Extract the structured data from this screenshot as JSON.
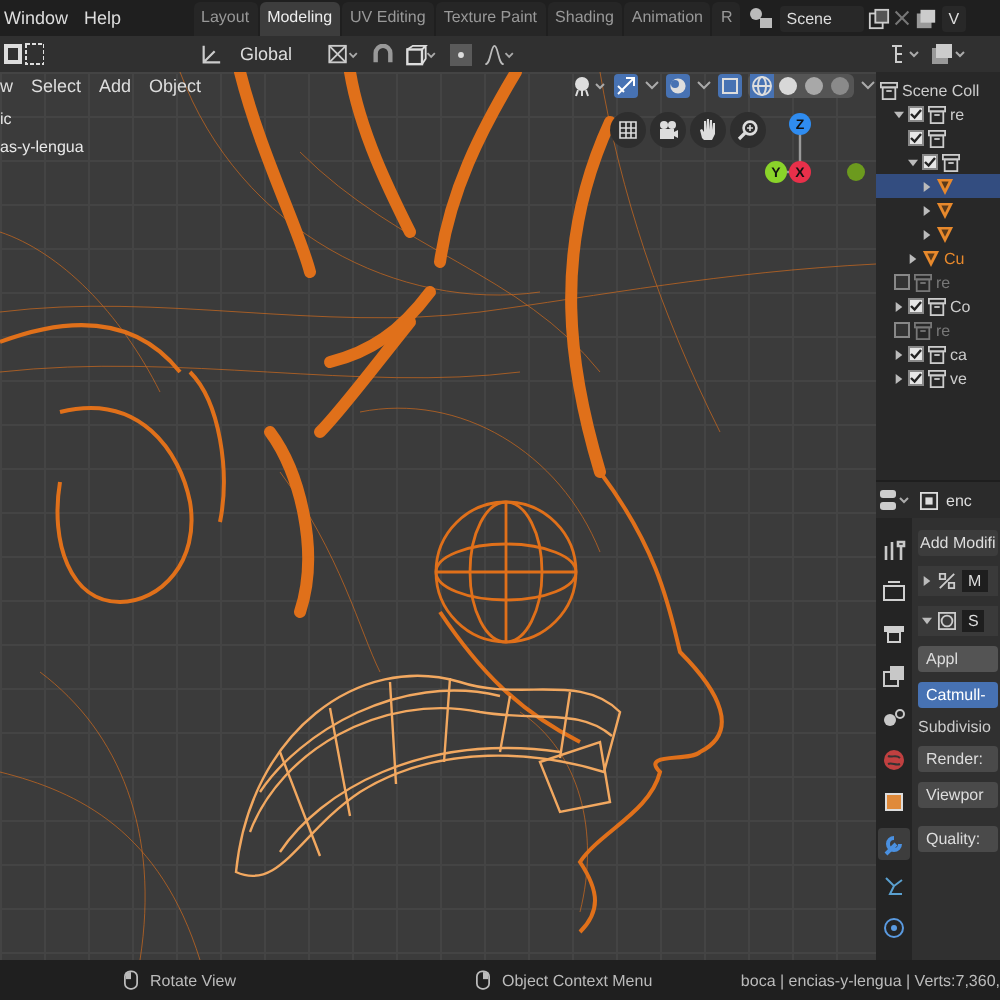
{
  "top_bar": {
    "menus": [
      "Window",
      "Help"
    ],
    "workspace_tabs": [
      {
        "label": "Layout",
        "selected": false
      },
      {
        "label": "Modeling",
        "selected": true
      },
      {
        "label": "UV Editing",
        "selected": false
      },
      {
        "label": "Texture Paint",
        "selected": false
      },
      {
        "label": "Shading",
        "selected": false
      },
      {
        "label": "Animation",
        "selected": false
      },
      {
        "label": "R",
        "selected": false
      }
    ],
    "scene": "Scene",
    "view_layer": "V"
  },
  "tool_header": {
    "orientation": "Global"
  },
  "viewport": {
    "menus": [
      "w",
      "Select",
      "Add",
      "Object"
    ],
    "overlay_text": [
      "ic",
      "as-y-lengua"
    ],
    "shading_buttons": [
      {
        "kind": "wireframe",
        "selected": true
      },
      {
        "kind": "solid",
        "selected": false
      },
      {
        "kind": "material",
        "selected": false
      },
      {
        "kind": "rendered",
        "selected": false
      }
    ],
    "gizmo_axes": [
      {
        "label": "Z",
        "color": "#2f8cf0"
      },
      {
        "label": "Y",
        "color": "#8ad42a"
      },
      {
        "label": "X",
        "color": "#e8304a"
      }
    ]
  },
  "outliner": {
    "items": [
      {
        "label": "Scene Coll",
        "kind": "collection",
        "selected": false,
        "children": [
          {
            "label": "re",
            "kind": "collection",
            "checked": true,
            "expanded": true,
            "selected": false,
            "children": [
              {
                "kind": "collection",
                "checked": true,
                "selected": false
              },
              {
                "kind": "collection",
                "checked": true,
                "expanded": true,
                "selected": false,
                "children": [
                  {
                    "kind": "mesh",
                    "expanded": false,
                    "selected": true
                  },
                  {
                    "kind": "mesh",
                    "expanded": false,
                    "selected": false
                  },
                  {
                    "kind": "mesh",
                    "expanded": false,
                    "selected": false
                  }
                ]
              },
              {
                "label": "Cu",
                "kind": "mesh",
                "expanded": false,
                "selected": false
              }
            ]
          },
          {
            "label": "re",
            "kind": "collection",
            "checked": false,
            "selected": false
          },
          {
            "label": "Co",
            "kind": "collection",
            "checked": true,
            "expanded": false,
            "selected": false
          },
          {
            "label": "re",
            "kind": "collection",
            "checked": false,
            "selected": false
          },
          {
            "label": "ca",
            "kind": "collection",
            "checked": true,
            "expanded": false,
            "selected": false
          },
          {
            "label": "ve",
            "kind": "collection",
            "checked": true,
            "expanded": false,
            "selected": false
          }
        ]
      }
    ]
  },
  "properties": {
    "object_name": "enc",
    "tabs": [
      {
        "kind": "tool",
        "selected": false
      },
      {
        "kind": "render",
        "selected": false
      },
      {
        "kind": "output",
        "selected": false
      },
      {
        "kind": "view_layer",
        "selected": false
      },
      {
        "kind": "scene",
        "selected": false
      },
      {
        "kind": "world",
        "selected": false
      },
      {
        "kind": "object",
        "selected": false
      },
      {
        "kind": "modifier",
        "selected": true
      },
      {
        "kind": "particles",
        "selected": false
      },
      {
        "kind": "physics",
        "selected": false
      }
    ],
    "add_modifier": "Add Modifi",
    "modifiers": [
      {
        "name": "M",
        "kind": "mirror",
        "expanded": false
      },
      {
        "name": "S",
        "kind": "subdivision",
        "expanded": true
      }
    ],
    "apply": "Appl",
    "subdivision_types": [
      {
        "label": "Catmull-",
        "selected": true
      }
    ],
    "subdivisions_label": "Subdivisio",
    "fields": [
      "Render:",
      "Viewpor"
    ],
    "quality": "Quality:"
  },
  "status_bar": {
    "hints": [
      "Rotate View",
      "Object Context Menu"
    ],
    "stats": "boca | encias-y-lengua | Verts:7,360,"
  }
}
